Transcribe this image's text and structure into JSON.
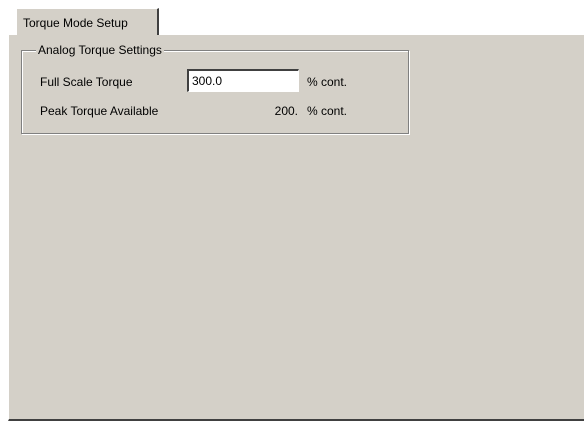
{
  "tabs": [
    {
      "label": "Torque Mode Setup",
      "active": true
    }
  ],
  "group": {
    "title": "Analog Torque Settings"
  },
  "full_scale_torque": {
    "label": "Full Scale Torque",
    "value": "300.0",
    "unit": "% cont."
  },
  "peak_torque_available": {
    "label": "Peak Torque Available",
    "value": "200.",
    "unit": "% cont."
  },
  "colors": {
    "panel_background": "#d4d0c8",
    "highlight": "#ffffff",
    "shadow": "#808080",
    "dark_shadow": "#404040"
  }
}
